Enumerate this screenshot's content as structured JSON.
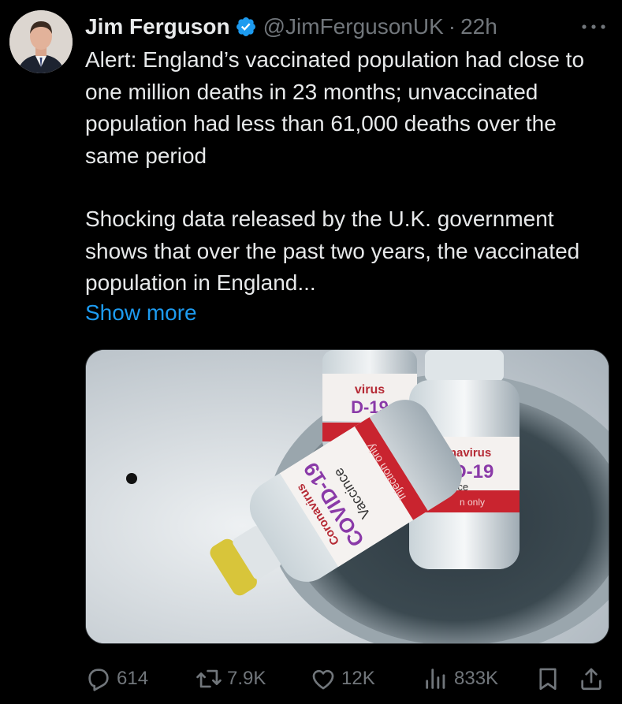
{
  "author": {
    "name": "Jim Ferguson",
    "handle": "@JimFergusonUK",
    "separator": "·",
    "time": "22h"
  },
  "tweet": {
    "paragraph_1": "Alert: England’s vaccinated population had close to one million deaths in 23 months; unvaccinated population had less than 61,000 deaths over the same period",
    "paragraph_2": "Shocking data released by the U.K. government shows that over the past two years, the vaccinated population in England...",
    "show_more": "Show more"
  },
  "media": {
    "vial_front": {
      "line1": "Coronavirus",
      "line2": "COVID-19",
      "line3": "Vaccince",
      "line4": "Injection only"
    },
    "vial_right": {
      "line1": "ronavirus",
      "line2": "VID-19",
      "line3": "cince",
      "line4": "n only"
    },
    "vial_back": {
      "line1": "virus",
      "line2": "D-19"
    }
  },
  "actions": {
    "replies": "614",
    "reposts": "7.9K",
    "likes": "12K",
    "views": "833K"
  },
  "colors": {
    "background": "#000000",
    "text": "#e7e9ea",
    "muted": "#71767b",
    "link": "#1d9bf0",
    "verified": "#1d9bf0"
  },
  "icons": [
    "verified-badge-icon",
    "more-icon",
    "reply-icon",
    "repost-icon",
    "like-icon",
    "views-icon",
    "bookmark-icon",
    "share-icon"
  ]
}
